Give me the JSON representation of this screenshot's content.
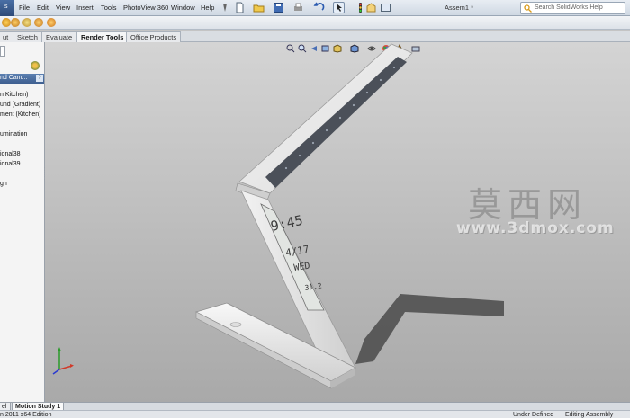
{
  "menubar": {
    "logo_glyph": "s",
    "items": [
      "File",
      "Edit",
      "View",
      "Insert",
      "Tools",
      "PhotoView 360",
      "Window",
      "Help"
    ],
    "document_title": "Assem1 *",
    "help_placeholder": "Search SolidWorks Help"
  },
  "command_tabs": [
    "ut",
    "Sketch",
    "Evaluate",
    "Render Tools",
    "Office Products"
  ],
  "active_tab": "Render Tools",
  "left_panel": {
    "header": "nd Cam...",
    "help_glyph": "?",
    "items": [
      "n Kitchen)",
      "und (Gradient)",
      "ment (Kitchen)",
      "umination",
      "ional38",
      "ional39",
      "gh"
    ]
  },
  "viewport": {
    "watermark_cn": "莫西网",
    "watermark_url": "www.3dmox.com",
    "lamp_display": {
      "time": "9:45",
      "date": "4/17",
      "day": "WED",
      "temp": "31.2"
    },
    "triad_icon": "coordinate-triad-icon"
  },
  "bottom_tabs": [
    "el",
    "Motion Study 1"
  ],
  "status": {
    "edition": "n 2011 x64 Edition",
    "definition": "Under Defined",
    "mode": "Editing Assembly"
  },
  "colors": {
    "menubar": "#dde4ec",
    "viewport_top": "#d4d4d4",
    "viewport_bottom": "#a9a9a9",
    "lamp_body": "#e9e9e9",
    "lamp_dark": "#4a4f56",
    "panel_header": "#4a6d9f"
  }
}
